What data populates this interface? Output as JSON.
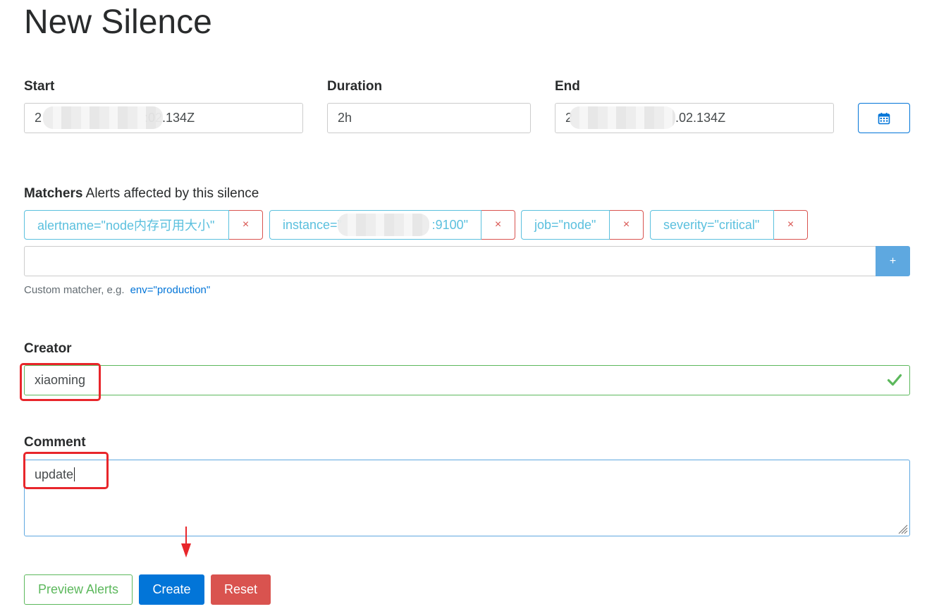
{
  "page": {
    "title": "New Silence"
  },
  "start": {
    "label": "Start",
    "value_prefix": "2",
    "value_suffix": ":02.134Z"
  },
  "duration": {
    "label": "Duration",
    "value": "2h"
  },
  "end": {
    "label": "End",
    "value_prefix": "2",
    "value_suffix": ".02.134Z",
    "calendar_icon": "calendar-icon"
  },
  "matchers": {
    "title": "Matchers",
    "subtitle": "Alerts affected by this silence",
    "items": [
      {
        "text": "alertname=\"node内存可用大小\"",
        "remove": "×"
      },
      {
        "text_prefix": "instance=\"",
        "text_suffix": ":9100\"",
        "remove": "×"
      },
      {
        "text": "job=\"node\"",
        "remove": "×"
      },
      {
        "text": "severity=\"critical\"",
        "remove": "×"
      }
    ],
    "input_value": "",
    "add_label": "+",
    "hint": "Custom matcher, e.g.",
    "hint_example": "env=\"production\""
  },
  "creator": {
    "label": "Creator",
    "value": "xiaoming",
    "valid_icon": "check-icon"
  },
  "comment": {
    "label": "Comment",
    "value": "update"
  },
  "actions": {
    "preview": "Preview Alerts",
    "create": "Create",
    "reset": "Reset"
  },
  "colors": {
    "primary": "#0275d8",
    "info": "#5bc0de",
    "danger": "#d9534f",
    "success": "#5cb85c",
    "annotation": "#e8262b"
  }
}
